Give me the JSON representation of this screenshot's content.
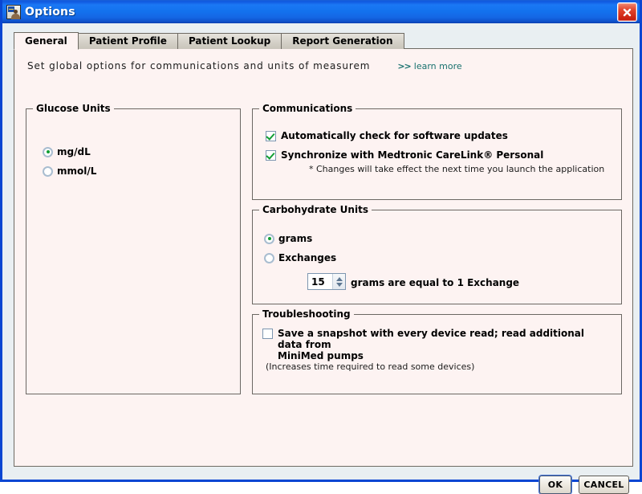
{
  "window": {
    "title": "Options",
    "icon": "options-app-icon",
    "close_icon": "close-icon"
  },
  "tabs": [
    {
      "label": "General",
      "active": true
    },
    {
      "label": "Patient Profile",
      "active": false
    },
    {
      "label": "Patient Lookup",
      "active": false
    },
    {
      "label": "Report Generation",
      "active": false
    }
  ],
  "description": {
    "text": "Set global options for communications and units of measurem",
    "learn_more_arrows": ">>",
    "learn_more_label": "learn more",
    "learn_more_color": "#19716e"
  },
  "glucose_units": {
    "legend": "Glucose Units",
    "options": [
      {
        "label": "mg/dL",
        "selected": true
      },
      {
        "label": "mmol/L",
        "selected": false
      }
    ]
  },
  "communications": {
    "legend": "Communications",
    "options": [
      {
        "label": "Automatically check for software updates",
        "checked": true
      },
      {
        "label": "Synchronize with Medtronic CareLink® Personal",
        "checked": true
      }
    ],
    "note": "* Changes will take effect the next time you launch the application"
  },
  "carbohydrate_units": {
    "legend": "Carbohydrate Units",
    "options": [
      {
        "label": "grams",
        "selected": true
      },
      {
        "label": "Exchanges",
        "selected": false
      }
    ],
    "spinner": {
      "value": "15",
      "up_icon": "arrow-up-icon",
      "down_icon": "arrow-down-icon"
    },
    "spinner_suffix": "grams are equal to 1 Exchange"
  },
  "troubleshooting": {
    "legend": "Troubleshooting",
    "option": {
      "label_line1": "Save a snapshot with every device read; read additional data from",
      "label_line2": "MiniMed pumps",
      "checked": false
    },
    "note": "(Increases time required to read some devices)"
  },
  "buttons": {
    "ok": "OK",
    "cancel": "CANCEL"
  },
  "colors": {
    "titlebar_blue": "#1372ee",
    "window_border": "#0a46d2",
    "panel_bg": "#fdf3f2",
    "dialog_bg": "#e9eff2",
    "check_green": "#119e33",
    "link_teal": "#19716e"
  }
}
